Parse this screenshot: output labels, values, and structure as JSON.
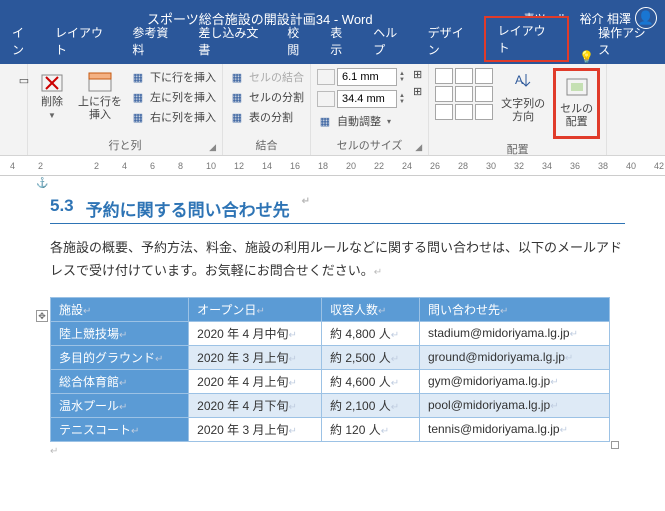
{
  "titlebar": {
    "doc": "スポーツ総合施設の開設計画34  -  Word",
    "tools": "表ツール",
    "user": "裕介 相澤"
  },
  "tabs": {
    "items": [
      "イン",
      "レイアウト",
      "参考資料",
      "差し込み文書",
      "校閲",
      "表示",
      "ヘルプ",
      "デザイン",
      "レイアウト"
    ],
    "tell": "操作アシス"
  },
  "ribbon": {
    "delete": "削除",
    "insert_rc": "上に行を\n挿入",
    "row_below": "下に行を挿入",
    "col_left": "左に列を挿入",
    "col_right": "右に列を挿入",
    "rows_cols": "行と列",
    "merge_cells": "セルの結合",
    "split_cells": "セルの分割",
    "split_table": "表の分割",
    "merge_group": "結合",
    "height_val": "6.1 mm",
    "width_val": "34.4 mm",
    "autofit": "自動調整",
    "cellsize_group": "セルのサイズ",
    "text_dir": "文字列の\n方向",
    "cell_align": "セルの\n配置",
    "align_group": "配置"
  },
  "ruler": [
    "4",
    "2",
    "",
    "2",
    "4",
    "6",
    "8",
    "10",
    "12",
    "14",
    "16",
    "18",
    "20",
    "22",
    "24",
    "26",
    "28",
    "30",
    "32",
    "34",
    "36",
    "38",
    "40",
    "42"
  ],
  "doc": {
    "sec_num": "5.3",
    "sec_title": "予約に関する問い合わせ先",
    "para": "各施設の概要、予約方法、料金、施設の利用ルールなどに関する問い合わせは、以下のメールアドレスで受け付けています。お気軽にお問合せください。",
    "headers": [
      "施設",
      "オープン日",
      "収容人数",
      "問い合わせ先"
    ],
    "rows": [
      {
        "f": "陸上競技場",
        "o": "2020 年 4 月中旬",
        "c": "約 4,800 人",
        "m": "stadium@midoriyama.lg.jp"
      },
      {
        "f": "多目的グラウンド",
        "o": "2020 年 3 月上旬",
        "c": "約 2,500 人",
        "m": "ground@midoriyama.lg.jp"
      },
      {
        "f": "総合体育館",
        "o": "2020 年 4 月上旬",
        "c": "約 4,600 人",
        "m": "gym@midoriyama.lg.jp"
      },
      {
        "f": "温水プール",
        "o": "2020 年 4 月下旬",
        "c": "約 2,100 人",
        "m": "pool@midoriyama.lg.jp"
      },
      {
        "f": "テニスコート",
        "o": "2020 年 3 月上旬",
        "c": "約 120 人",
        "m": "tennis@midoriyama.lg.jp"
      }
    ]
  }
}
